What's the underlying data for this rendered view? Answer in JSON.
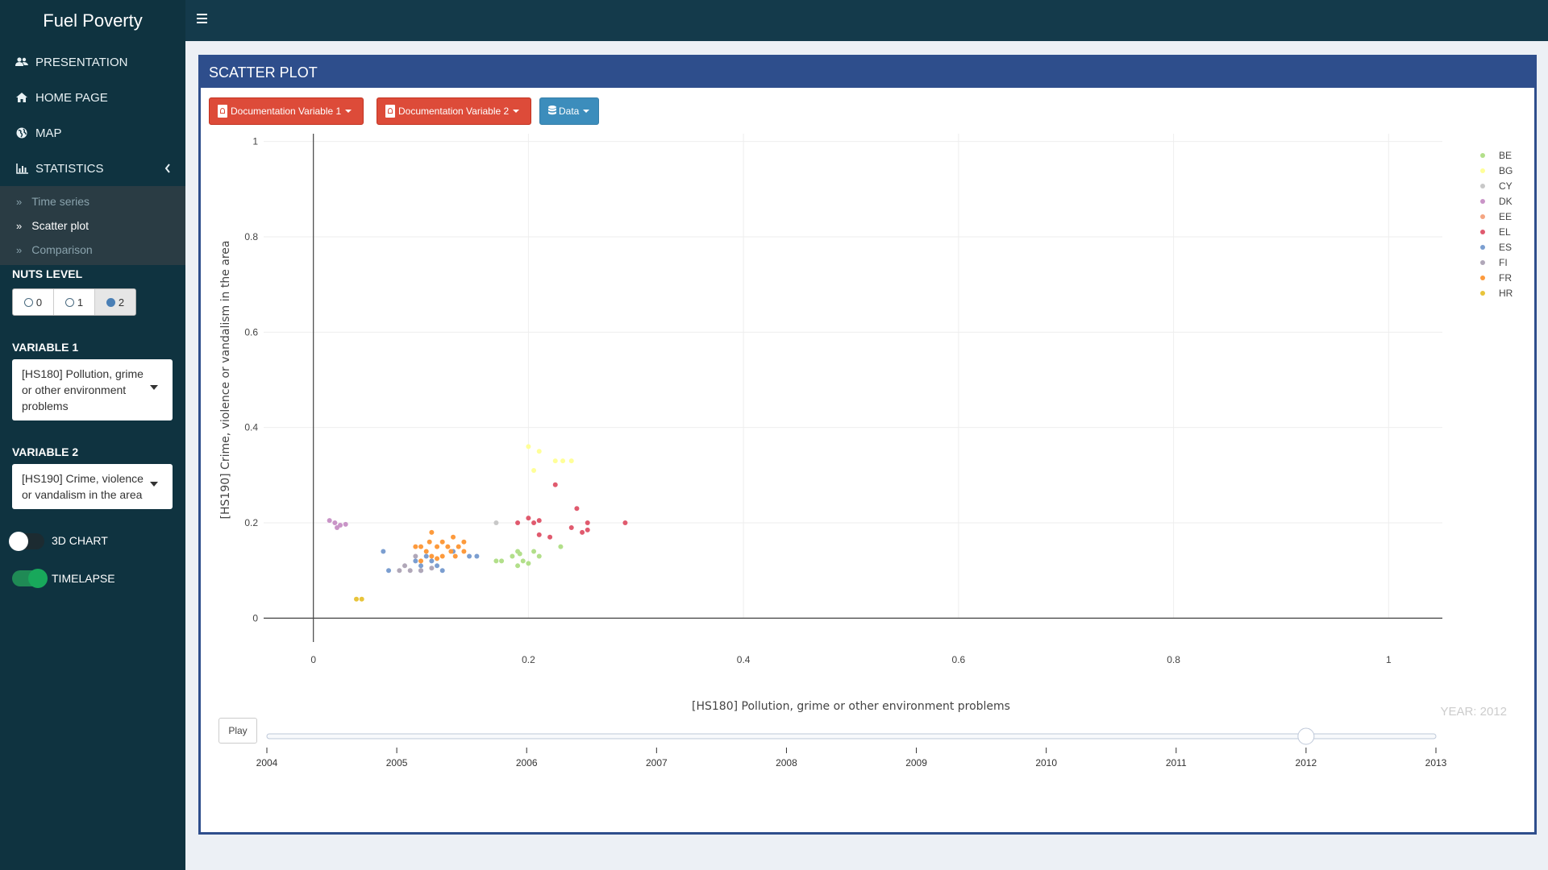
{
  "app": {
    "title": "Fuel Poverty"
  },
  "sidebar": {
    "menu": [
      {
        "label": "PRESENTATION",
        "icon": "users-icon"
      },
      {
        "label": "HOME PAGE",
        "icon": "home-icon"
      },
      {
        "label": "MAP",
        "icon": "globe-icon"
      },
      {
        "label": "STATISTICS",
        "icon": "bar-chart-icon"
      }
    ],
    "submenu": [
      {
        "label": "Time series"
      },
      {
        "label": "Scatter plot"
      },
      {
        "label": "Comparison"
      }
    ],
    "nuts_label": "NUTS LEVEL",
    "nuts_options": [
      "0",
      "1",
      "2"
    ],
    "nuts_selected": "2",
    "var1_label": "VARIABLE 1",
    "var1_value": "[HS180] Pollution, grime or other environment problems",
    "var2_label": "VARIABLE 2",
    "var2_value": "[HS190] Crime, violence or vandalism in the area",
    "chart3d_label": "3D CHART",
    "chart3d_on": false,
    "timelapse_label": "TIMELAPSE",
    "timelapse_on": true
  },
  "panel": {
    "title": "SCATTER PLOT",
    "btn_doc1": "Documentation Variable 1",
    "btn_doc2": "Documentation Variable 2",
    "btn_data": "Data",
    "play_label": "Play",
    "year_label": "YEAR: 2012"
  },
  "colors": {
    "header": "#143a4b",
    "sidebar": "#0f3340",
    "box": "#2e4e8c"
  },
  "chart_data": {
    "type": "scatter",
    "xlabel": "[HS180] Pollution, grime or other environment problems",
    "ylabel": "[HS190] Crime, violence or vandalism in the area",
    "xlim": [
      -0.05,
      1.05
    ],
    "ylim": [
      -0.05,
      1.05
    ],
    "xticks": [
      0,
      0.2,
      0.4,
      0.6,
      0.8,
      1
    ],
    "yticks": [
      0,
      0.2,
      0.4,
      0.6,
      0.8,
      1
    ],
    "legend_position": "top-right",
    "grid": true,
    "series": [
      {
        "name": "BE",
        "color": "#b2df8a",
        "points": [
          [
            0.17,
            0.12
          ],
          [
            0.175,
            0.12
          ],
          [
            0.185,
            0.13
          ],
          [
            0.19,
            0.14
          ],
          [
            0.19,
            0.11
          ],
          [
            0.195,
            0.12
          ],
          [
            0.2,
            0.115
          ],
          [
            0.205,
            0.14
          ],
          [
            0.21,
            0.13
          ],
          [
            0.23,
            0.15
          ],
          [
            0.192,
            0.135
          ]
        ]
      },
      {
        "name": "BG",
        "color": "#ffff99",
        "points": [
          [
            0.2,
            0.36
          ],
          [
            0.205,
            0.31
          ],
          [
            0.21,
            0.35
          ],
          [
            0.225,
            0.33
          ],
          [
            0.232,
            0.33
          ],
          [
            0.24,
            0.33
          ]
        ]
      },
      {
        "name": "CY",
        "color": "#c8c8c8",
        "points": [
          [
            0.17,
            0.2
          ]
        ]
      },
      {
        "name": "DK",
        "color": "#c994c7",
        "points": [
          [
            0.015,
            0.205
          ],
          [
            0.02,
            0.2
          ],
          [
            0.022,
            0.19
          ],
          [
            0.025,
            0.195
          ],
          [
            0.03,
            0.197
          ]
        ]
      },
      {
        "name": "EE",
        "color": "#f4a582",
        "points": []
      },
      {
        "name": "EL",
        "color": "#e05a6e",
        "points": [
          [
            0.19,
            0.2
          ],
          [
            0.2,
            0.21
          ],
          [
            0.205,
            0.2
          ],
          [
            0.21,
            0.205
          ],
          [
            0.21,
            0.175
          ],
          [
            0.22,
            0.17
          ],
          [
            0.225,
            0.28
          ],
          [
            0.24,
            0.19
          ],
          [
            0.245,
            0.23
          ],
          [
            0.25,
            0.18
          ],
          [
            0.255,
            0.185
          ],
          [
            0.255,
            0.2
          ],
          [
            0.29,
            0.2
          ]
        ]
      },
      {
        "name": "ES",
        "color": "#7b9ed0",
        "points": [
          [
            0.065,
            0.14
          ],
          [
            0.07,
            0.1
          ],
          [
            0.095,
            0.12
          ],
          [
            0.1,
            0.11
          ],
          [
            0.1,
            0.1
          ],
          [
            0.105,
            0.13
          ],
          [
            0.11,
            0.12
          ],
          [
            0.115,
            0.11
          ],
          [
            0.12,
            0.1
          ],
          [
            0.13,
            0.14
          ],
          [
            0.145,
            0.13
          ],
          [
            0.152,
            0.13
          ]
        ]
      },
      {
        "name": "FI",
        "color": "#b0a7b8",
        "points": [
          [
            0.08,
            0.1
          ],
          [
            0.085,
            0.11
          ],
          [
            0.09,
            0.1
          ],
          [
            0.095,
            0.13
          ],
          [
            0.1,
            0.1
          ],
          [
            0.11,
            0.105
          ]
        ]
      },
      {
        "name": "FR",
        "color": "#fd9a3c",
        "points": [
          [
            0.095,
            0.15
          ],
          [
            0.1,
            0.15
          ],
          [
            0.105,
            0.14
          ],
          [
            0.108,
            0.16
          ],
          [
            0.11,
            0.18
          ],
          [
            0.11,
            0.13
          ],
          [
            0.115,
            0.15
          ],
          [
            0.12,
            0.16
          ],
          [
            0.12,
            0.13
          ],
          [
            0.125,
            0.15
          ],
          [
            0.128,
            0.14
          ],
          [
            0.13,
            0.17
          ],
          [
            0.132,
            0.13
          ],
          [
            0.135,
            0.15
          ],
          [
            0.14,
            0.16
          ],
          [
            0.14,
            0.14
          ],
          [
            0.1,
            0.12
          ],
          [
            0.115,
            0.125
          ]
        ]
      },
      {
        "name": "HR",
        "color": "#e8c43a",
        "points": [
          [
            0.04,
            0.04
          ],
          [
            0.045,
            0.04
          ]
        ]
      }
    ],
    "slider": {
      "years": [
        "2004",
        "2005",
        "2006",
        "2007",
        "2008",
        "2009",
        "2010",
        "2011",
        "2012",
        "2013"
      ],
      "current": "2012"
    }
  }
}
